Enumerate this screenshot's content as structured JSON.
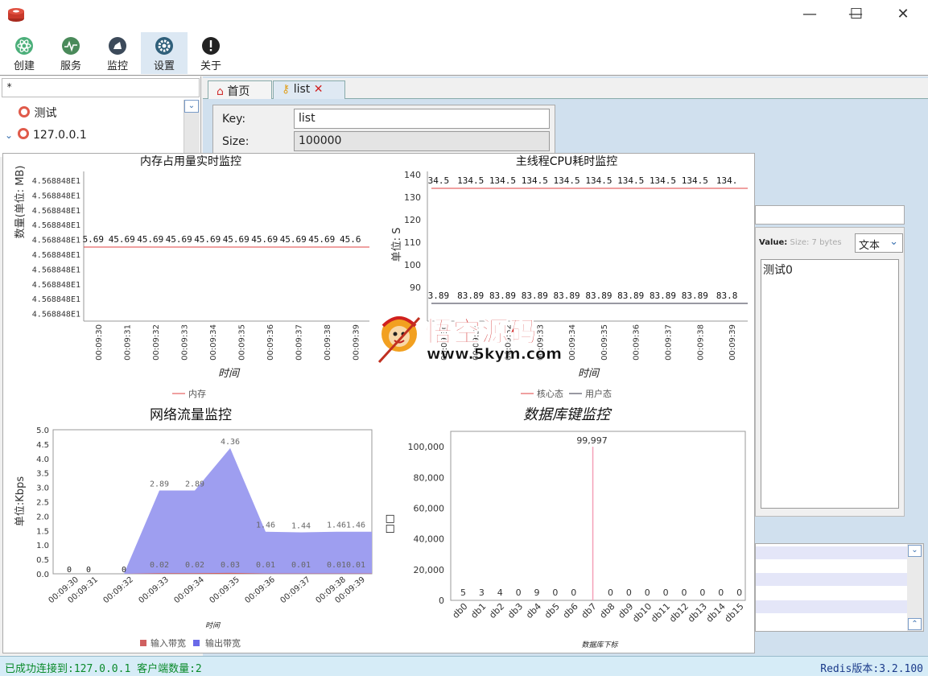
{
  "window": {
    "minimize": "—",
    "maximize": "☐",
    "close": "✕"
  },
  "toolbar": [
    {
      "label": "创建",
      "icon": "atom-icon"
    },
    {
      "label": "服务",
      "icon": "wave-icon"
    },
    {
      "label": "监控",
      "icon": "monitor-icon"
    },
    {
      "label": "设置",
      "icon": "gear-icon"
    },
    {
      "label": "关于",
      "icon": "info-icon"
    }
  ],
  "search": {
    "value": "*"
  },
  "tree": [
    {
      "label": "测试"
    },
    {
      "label": "127.0.0.1"
    }
  ],
  "tabs": {
    "home": "首页",
    "list": "list"
  },
  "detail": {
    "key_label": "Key:",
    "key_value": "list",
    "size_label": "Size:",
    "size_value": "100000"
  },
  "value_panel": {
    "label": "Value:",
    "size_hint": "Size: 7 bytes",
    "format": "文本",
    "content": "测试0"
  },
  "status": {
    "left": "已成功连接到:127.0.0.1 客户端数量:2",
    "right": "Redis版本:3.2.100"
  },
  "colors": {
    "red": "#e04040",
    "blue": "#6a6ae8",
    "area": "#9e9ef0",
    "pink": "#f4a0b8"
  },
  "watermark": {
    "text": "悟空源码",
    "url": "www.5kym.com"
  },
  "chart_data": [
    {
      "type": "line",
      "title": "内存占用量实时监控",
      "xlabel": "时间",
      "ylabel": "数量(单位: MB)",
      "x": [
        "00:09:30",
        "00:09:31",
        "00:09:32",
        "00:09:33",
        "00:09:34",
        "00:09:35",
        "00:09:36",
        "00:09:37",
        "00:09:38",
        "00:09:39"
      ],
      "yticks": [
        "4.568848E1",
        "4.568848E1",
        "4.568848E1",
        "4.568848E1",
        "4.568848E1",
        "4.568848E1",
        "4.568848E1",
        "4.568848E1",
        "4.568848E1",
        "4.568848E1"
      ],
      "series": [
        {
          "name": "内存",
          "values": [
            45.69,
            45.69,
            45.69,
            45.69,
            45.69,
            45.69,
            45.69,
            45.69,
            45.69,
            45.69
          ],
          "labels": [
            "5.69",
            "45.69",
            "45.69",
            "45.69",
            "45.69",
            "45.69",
            "45.69",
            "45.69",
            "45.69",
            "45.6"
          ]
        }
      ],
      "legend": "bottom"
    },
    {
      "type": "line",
      "title": "主线程CPU耗时监控",
      "xlabel": "时间",
      "ylabel": "单位: S",
      "x": [
        "00:09:30",
        "00:09:31",
        "00:09:32",
        "00:09:33",
        "00:09:34",
        "00:09:35",
        "00:09:36",
        "00:09:37",
        "00:09:38",
        "00:09:39"
      ],
      "ylim": [
        85,
        140
      ],
      "yticks": [
        90,
        100,
        110,
        120,
        130,
        140
      ],
      "series": [
        {
          "name": "核心态",
          "values": [
            134.5,
            134.5,
            134.5,
            134.5,
            134.5,
            134.5,
            134.5,
            134.5,
            134.5,
            134.5
          ],
          "labels": [
            "34.5",
            "134.5",
            "134.5",
            "134.5",
            "134.5",
            "134.5",
            "134.5",
            "134.5",
            "134.5",
            "134."
          ]
        },
        {
          "name": "用户态",
          "values": [
            83.89,
            83.89,
            83.89,
            83.89,
            83.89,
            83.89,
            83.89,
            83.89,
            83.89,
            83.89
          ],
          "labels": [
            "3.89",
            "83.89",
            "83.89",
            "83.89",
            "83.89",
            "83.89",
            "83.89",
            "83.89",
            "83.89",
            "83.8"
          ]
        }
      ],
      "legend": "bottom"
    },
    {
      "type": "area",
      "title": "网络流量监控",
      "xlabel": "时间",
      "ylabel": "单位:Kbps",
      "x": [
        "00:09:30",
        "00:09:31",
        "00:09:32",
        "00:09:33",
        "00:09:34",
        "00:09:35",
        "00:09:36",
        "00:09:37",
        "00:09:38",
        "00:09:39"
      ],
      "ylim": [
        0,
        5
      ],
      "yticks": [
        "0.0",
        "0.5",
        "1.0",
        "1.5",
        "2.0",
        "2.5",
        "3.0",
        "3.5",
        "4.0",
        "4.5",
        "5.0"
      ],
      "series": [
        {
          "name": "输入带宽",
          "values": [
            0,
            0,
            0,
            0.02,
            0.02,
            0.03,
            0.01,
            0.01,
            0.01,
            0.01
          ],
          "labels": [
            "",
            "",
            "",
            "0.02",
            "0.02",
            "0.03",
            "0.01",
            "0.01",
            "0.01",
            "0.01"
          ]
        },
        {
          "name": "输出带宽",
          "values": [
            0,
            0,
            0,
            2.89,
            2.89,
            4.36,
            1.46,
            1.44,
            1.46,
            1.46
          ],
          "labels": [
            "0",
            "0",
            "0",
            "2.89",
            "2.89",
            "4.36",
            "1.46",
            "1.44",
            "1.46",
            "1.46"
          ]
        }
      ],
      "legend": "bottom"
    },
    {
      "type": "bar",
      "title": "数据库键监控",
      "xlabel": "数据库下标",
      "ylabel": "□□",
      "categories": [
        "db0",
        "db1",
        "db2",
        "db3",
        "db4",
        "db5",
        "db6",
        "db7",
        "db8",
        "db9",
        "db10",
        "db11",
        "db12",
        "db13",
        "db14",
        "db15"
      ],
      "values": [
        5,
        3,
        4,
        0,
        9,
        0,
        0,
        99997,
        0,
        0,
        0,
        0,
        0,
        0,
        0,
        0
      ],
      "labels": [
        "5",
        "3",
        "4",
        "0",
        "9",
        "0",
        "0",
        "99,997",
        "0",
        "0",
        "0",
        "0",
        "0",
        "0",
        "0",
        "0"
      ],
      "ylim": [
        0,
        110000
      ],
      "yticks": [
        "0",
        "20,000",
        "40,000",
        "60,000",
        "80,000",
        "100,000"
      ]
    }
  ]
}
